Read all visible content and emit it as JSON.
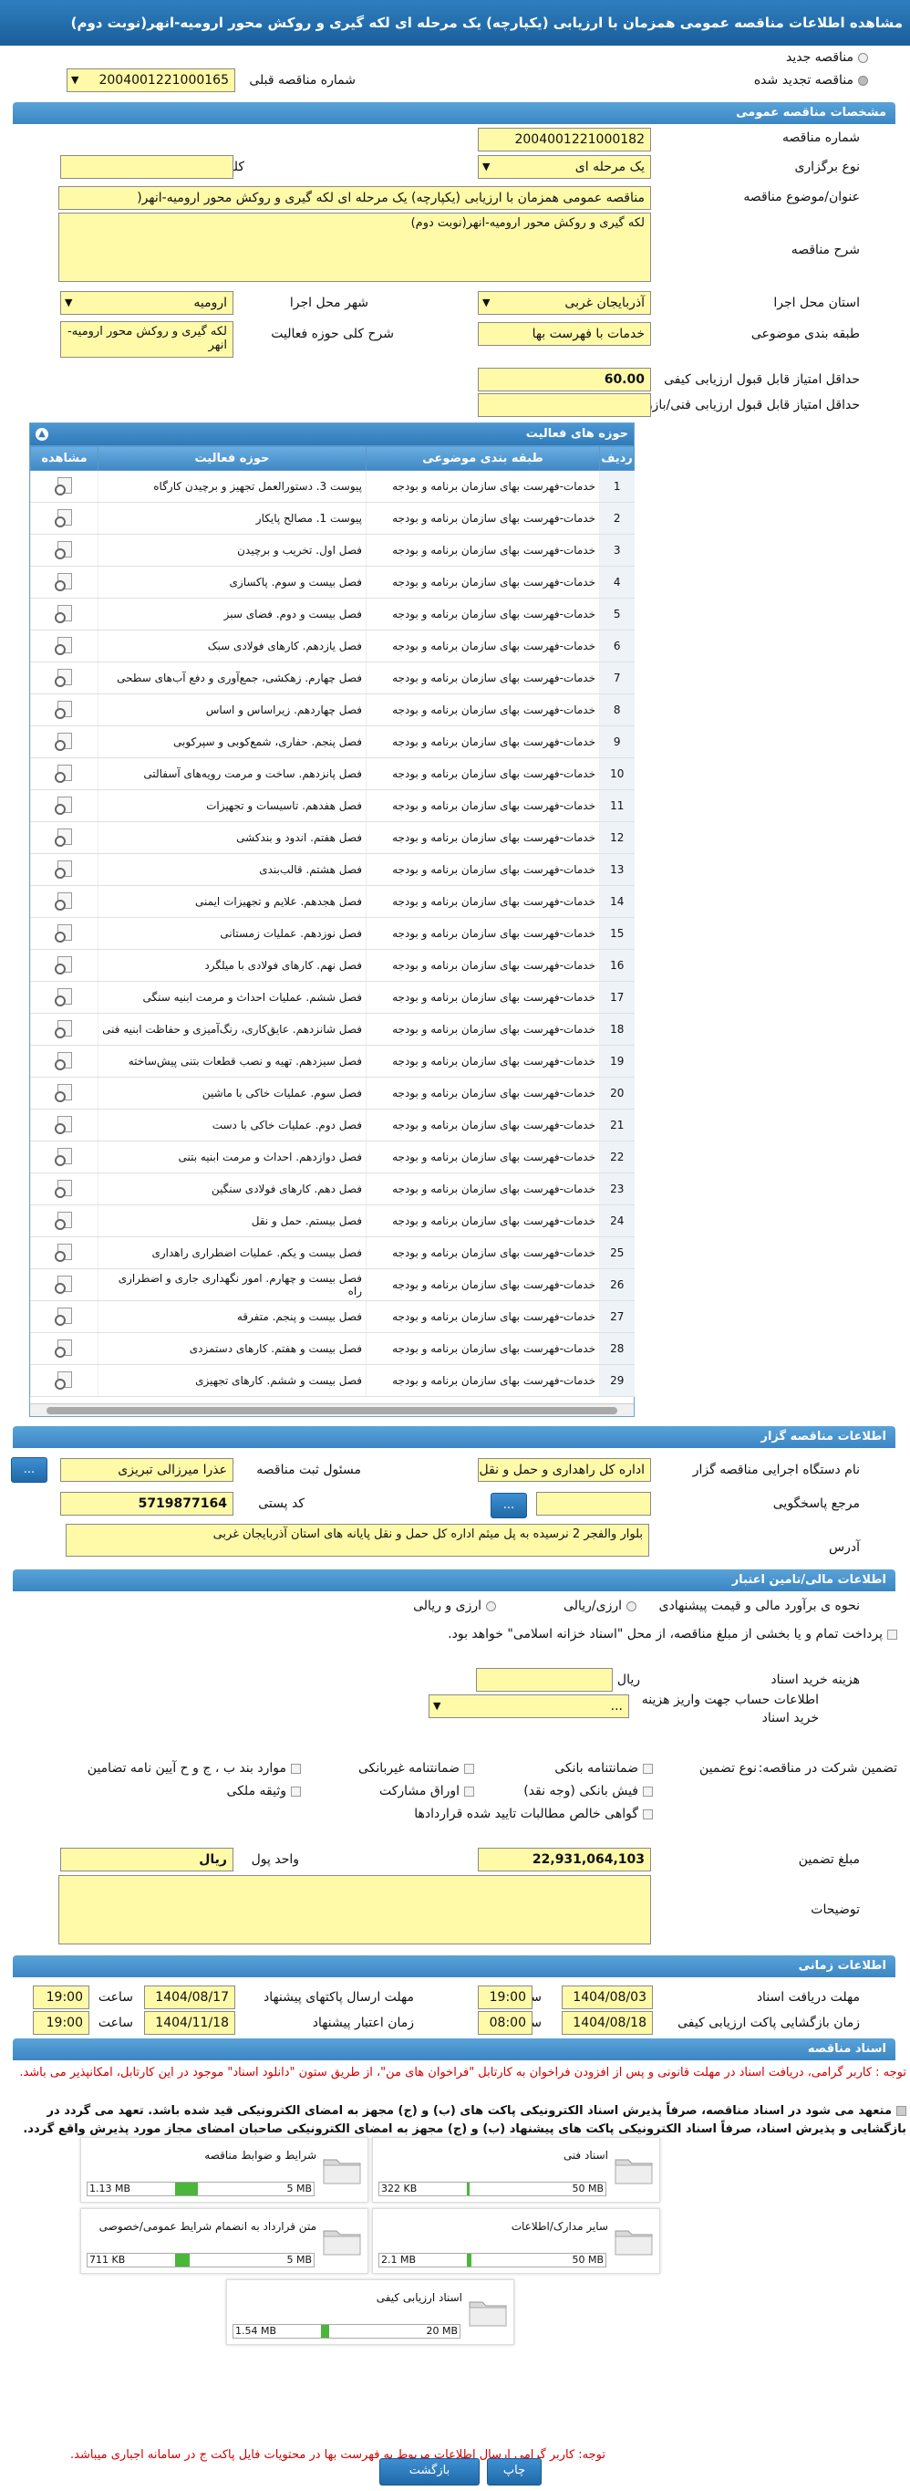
{
  "title": "مشاهده اطلاعات مناقصه عمومی همزمان با ارزیابی (یکپارچه) یک مرحله ای لکه گیری و روکش محور ارومیه-انهر(نوبت دوم)",
  "top": {
    "new_tender": "مناقصه جدید",
    "renewed_tender": "مناقصه تجدید شده",
    "prev_number_label": "شماره مناقصه قبلی",
    "prev_number": "2004001221000165"
  },
  "general": {
    "section": "مشخصات مناقصه عمومی",
    "number_label": "شماره مناقصه",
    "number": "2004001221000182",
    "holding_type_label": "نوع برگزاری",
    "holding_type": "یک مرحله ای",
    "keyword_label": "کلید واژه",
    "keyword": "",
    "subject_label": "عنوان/موضوع مناقصه",
    "subject": "مناقصه عمومی همزمان با ارزیابی (یکپارچه) یک مرحله ای لکه گیری و روکش محور ارومیه-انهر(",
    "desc_label": "شرح مناقصه",
    "desc": "لکه گیری و روکش محور ارومیه-انهر(نوبت دوم)",
    "province_label": "استان محل اجرا",
    "province": "آذربایجان غربی",
    "city_label": "شهر محل اجرا",
    "city": "ارومیه",
    "category_label": "طبقه بندی موضوعی",
    "category": "خدمات با فهرست بها",
    "scope_label": "شرح کلی حوزه فعالیت",
    "scope": "لکه گیری و روکش محور ارومیه-انهر",
    "min_quality_label": "حداقل امتیاز قابل قبول ارزیابی کیفی",
    "min_quality": "60.00",
    "min_tech_label": "حداقل امتیاز قابل قبول ارزیابی فنی/بازرگانی",
    "min_tech": ""
  },
  "activities": {
    "title": "حوزه های فعالیت",
    "headers": [
      "ردیف",
      "طبقه بندی موضوعی",
      "حوزه فعالیت",
      "مشاهده"
    ],
    "category_text": "خدمات-فهرست بهای سازمان برنامه و بودجه",
    "rows": [
      [
        "1",
        "پیوست 3. دستورالعمل تجهیز و برچیدن کارگاه"
      ],
      [
        "2",
        "پیوست 1. مصالح پایکار"
      ],
      [
        "3",
        "فصل اول. تخریب و برچیدن"
      ],
      [
        "4",
        "فصل بیست و سوم. پاکسازی"
      ],
      [
        "5",
        "فصل بیست و دوم. فضای سبز"
      ],
      [
        "6",
        "فصل یازدهم. کارهای فولادی سبک"
      ],
      [
        "7",
        "فصل چهارم. زهکشی، جمع‌آوری و دفع آب‌های سطحی"
      ],
      [
        "8",
        "فصل چهاردهم. زیراساس و اساس"
      ],
      [
        "9",
        "فصل پنجم. حفاری، شمع‌کوبی و سپرکوبی"
      ],
      [
        "10",
        "فصل پانزدهم. ساخت و مرمت رویه‌های آسفالتی"
      ],
      [
        "11",
        "فصل هفدهم. تاسیسات و تجهیزات"
      ],
      [
        "12",
        "فصل هفتم. اندود و بندکشی"
      ],
      [
        "13",
        "فصل هشتم. قالب‌بندی"
      ],
      [
        "14",
        "فصل هجدهم. علایم و تجهیزات ایمنی"
      ],
      [
        "15",
        "فصل نوزدهم. عملیات زمستانی"
      ],
      [
        "16",
        "فصل نهم. کارهای فولادی با میلگرد"
      ],
      [
        "17",
        "فصل ششم. عملیات احداث و مرمت ابنیه سنگی"
      ],
      [
        "18",
        "فصل شانزدهم. عایق‌کاری، رنگ‌آمیزی و حفاظت ابنیه فنی"
      ],
      [
        "19",
        "فصل سیزدهم. تهیه و نصب قطعات بتنی پیش‌ساخته"
      ],
      [
        "20",
        "فصل سوم. عملیات خاکی با ماشین"
      ],
      [
        "21",
        "فصل دوم. عملیات خاکی با دست"
      ],
      [
        "22",
        "فصل دوازدهم. احداث و مرمت ابنیه بتنی"
      ],
      [
        "23",
        "فصل دهم. کارهای فولادی سنگین"
      ],
      [
        "24",
        "فصل بیستم. حمل و نقل"
      ],
      [
        "25",
        "فصل بیست و یکم. عملیات اضطراری راهداری"
      ],
      [
        "26",
        "فصل بیست و چهارم. امور نگهداری جاری و اضطراری راه"
      ],
      [
        "27",
        "فصل بیست و پنجم. متفرقه"
      ],
      [
        "28",
        "فصل بیست و هفتم. کارهای دستمزدی"
      ],
      [
        "29",
        "فصل بیست و ششم. کارهای تجهیزی"
      ]
    ]
  },
  "organizer": {
    "section": "اطلاعات مناقصه گزار",
    "org_label": "نام دستگاه اجرایی مناقصه گزار",
    "org": "اداره کل راهداری و حمل و نقل",
    "resp_label": "مسئول ثبت مناقصه",
    "resp": "عذرا میرزالی تبریزی",
    "ref_label": "مرجع پاسخگویی",
    "ref": "",
    "postal_label": "کد پستی",
    "postal": "5719877164",
    "address_label": "آدرس",
    "address": "بلوار والفجر 2 نرسیده به پل میثم اداره کل حمل و نقل پایانه های استان آذربایجان غربی",
    "dots": "..."
  },
  "financial": {
    "section": "اطلاعات مالی/تامین اعتبار",
    "estimate_label": "نحوه ی برآورد مالی و قیمت پیشنهادی",
    "rial": "ارزی/ریالی",
    "rial2": "ارزی و ریالی",
    "treasury_text": "پرداخت تمام و یا بخشی از مبلغ مناقصه، از محل \"اسناد خزانه اسلامی\" خواهد بود.",
    "purchase_cost_label": "هزینه خرید اسناد",
    "currency_rial": "ریال",
    "account_label": "اطلاعات حساب جهت واریز هزینه خرید اسناد",
    "account": "..."
  },
  "guarantee": {
    "label": "تضمین شرکت در مناقصه:",
    "type_label": "نوع تضمین",
    "options": [
      "ضمانتنامه بانکی",
      "ضمانتنامه غیربانکی",
      "موارد بند ب ، ج و ح آیین نامه تضامین",
      "فیش بانکی (وجه نقد)",
      "اوراق مشارکت",
      "وثیقه ملکی",
      "گواهی خالص مطالبات تایید شده قراردادها"
    ],
    "amount_label": "مبلغ تضمین",
    "amount": "22,931,064,103",
    "unit_label": "واحد پول",
    "unit": "ریال",
    "notes_label": "توضیحات",
    "notes": ""
  },
  "timing": {
    "section": "اطلاعات زمانی",
    "receive_label": "مهلت دریافت اسناد",
    "receive_date": "1404/08/03",
    "receive_time": "19:00",
    "send_label": "مهلت ارسال پاکتهای پیشنهاد",
    "send_date": "1404/08/17",
    "send_time": "19:00",
    "open_label": "زمان بازگشایی پاکت ارزیابی کیفی",
    "open_date": "1404/08/18",
    "open_time": "08:00",
    "valid_label": "زمان اعتبار پیشنهاد",
    "valid_date": "1404/11/18",
    "valid_time": "19:00",
    "time_label": "ساعت"
  },
  "documents": {
    "section": "اسناد مناقصه",
    "note1": "توجه : کاربر گرامی، دریافت اسناد در مهلت قانونی و پس از افزودن فراخوان به کارتابل \"فراخوان های من\"، از طریق ستون \"دانلود اسناد\" موجود در این کارتابل، امکانپذیر می باشد.",
    "pledge": "متعهد می شود در اسناد مناقصه، صرفاً پذیرش اسناد الکترونیکی پاکت های (ب) و (ج) مجهز به امضای الکترونیکی قید شده باشد. تعهد می گردد در بازگشایی و پذیرش اسناد، صرفاً اسناد الکترونیکی پاکت های پیشنهاد (ب) و (ج) مجهز به امضای الکترونیکی صاحبان امضای مجاز مورد پذیرش واقع گردد.",
    "cards": [
      {
        "title": "اسناد فنی",
        "used": "322 KB",
        "max": "50 MB",
        "pct": 0.6
      },
      {
        "title": "شرایط و ضوابط مناقصه",
        "used": "1.13 MB",
        "max": "5 MB",
        "pct": 22
      },
      {
        "title": "سایر مدارک/اطلاعات",
        "used": "2.1 MB",
        "max": "50 MB",
        "pct": 4
      },
      {
        "title": "متن قرارداد به انضمام شرایط عمومی/خصوصی",
        "used": "711 KB",
        "max": "5 MB",
        "pct": 14
      },
      {
        "title": "اسناد ارزیابی کیفی",
        "used": "1.54 MB",
        "max": "20 MB",
        "pct": 8
      }
    ],
    "note2": "توجه: کاربر گرامی ارسال اطلاعات مربوط به فهرست بها در محتویات فایل پاکت ج در سامانه اجباری میباشد."
  },
  "buttons": {
    "print": "چاپ",
    "back": "بازگشت"
  }
}
